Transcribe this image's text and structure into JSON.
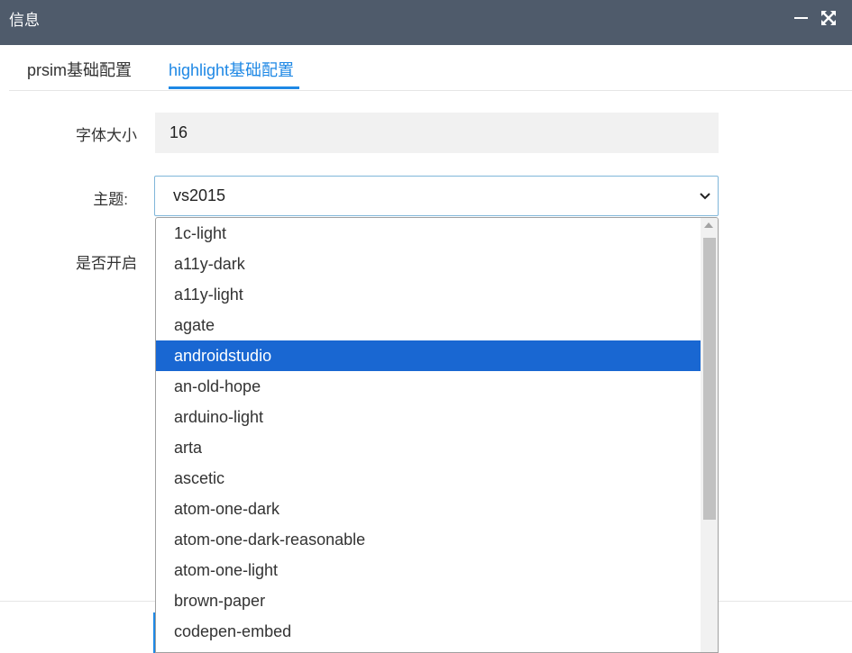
{
  "window": {
    "title": "信息",
    "controls": {
      "minimize_icon": "minimize-icon",
      "maximize_icon": "maximize-icon"
    },
    "titlebar_color": "#4f5b6b"
  },
  "tabs": [
    {
      "label": "prsim基础配置",
      "active": false
    },
    {
      "label": "highlight基础配置",
      "active": true
    }
  ],
  "accent_color": "#1e88e5",
  "form": {
    "font_size": {
      "label": "字体大小",
      "value": "16"
    },
    "theme": {
      "label": "主题:",
      "selected": "vs2015"
    },
    "enabled": {
      "label": "是否开启"
    }
  },
  "dropdown": {
    "highlighted": "androidstudio",
    "highlight_color": "#1967d2",
    "options": [
      "1c-light",
      "a11y-dark",
      "a11y-light",
      "agate",
      "androidstudio",
      "an-old-hope",
      "arduino-light",
      "arta",
      "ascetic",
      "atom-one-dark",
      "atom-one-dark-reasonable",
      "atom-one-light",
      "brown-paper",
      "codepen-embed"
    ]
  }
}
